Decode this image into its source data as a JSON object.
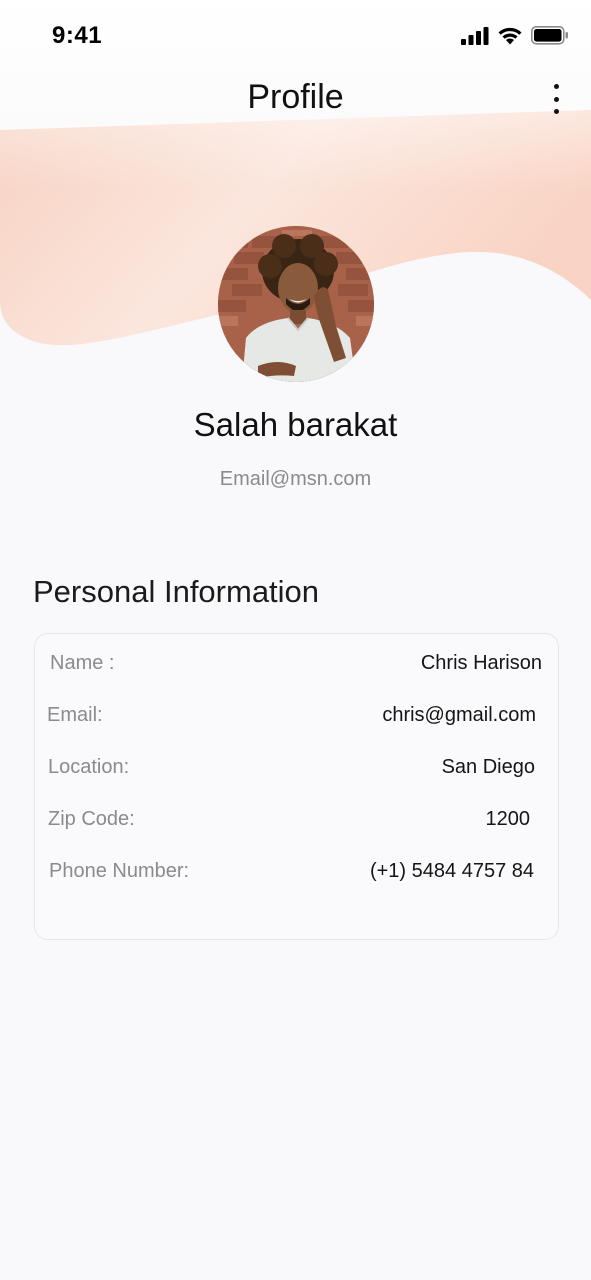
{
  "status_bar": {
    "time": "9:41",
    "icons": [
      "signal-icon",
      "wifi-icon",
      "battery-icon"
    ]
  },
  "header": {
    "title": "Profile",
    "menu_icon": "more-vertical-icon"
  },
  "profile": {
    "name": "Salah barakat",
    "email": "Email@msn.com"
  },
  "personal_info": {
    "title": "Personal Information",
    "rows": [
      {
        "label": "Name :",
        "value": "Chris Harison"
      },
      {
        "label": "Email:",
        "value": "chris@gmail.com"
      },
      {
        "label": "Location:",
        "value": "San Diego"
      },
      {
        "label": "Zip Code:",
        "value": "1200"
      },
      {
        "label": "Phone Number:",
        "value": "(+1) 5484 4757 84"
      }
    ]
  },
  "colors": {
    "background": "#f9f9fb",
    "wave": "#f9d9cb",
    "text_primary": "#111111",
    "text_secondary": "#8a8a8f"
  }
}
